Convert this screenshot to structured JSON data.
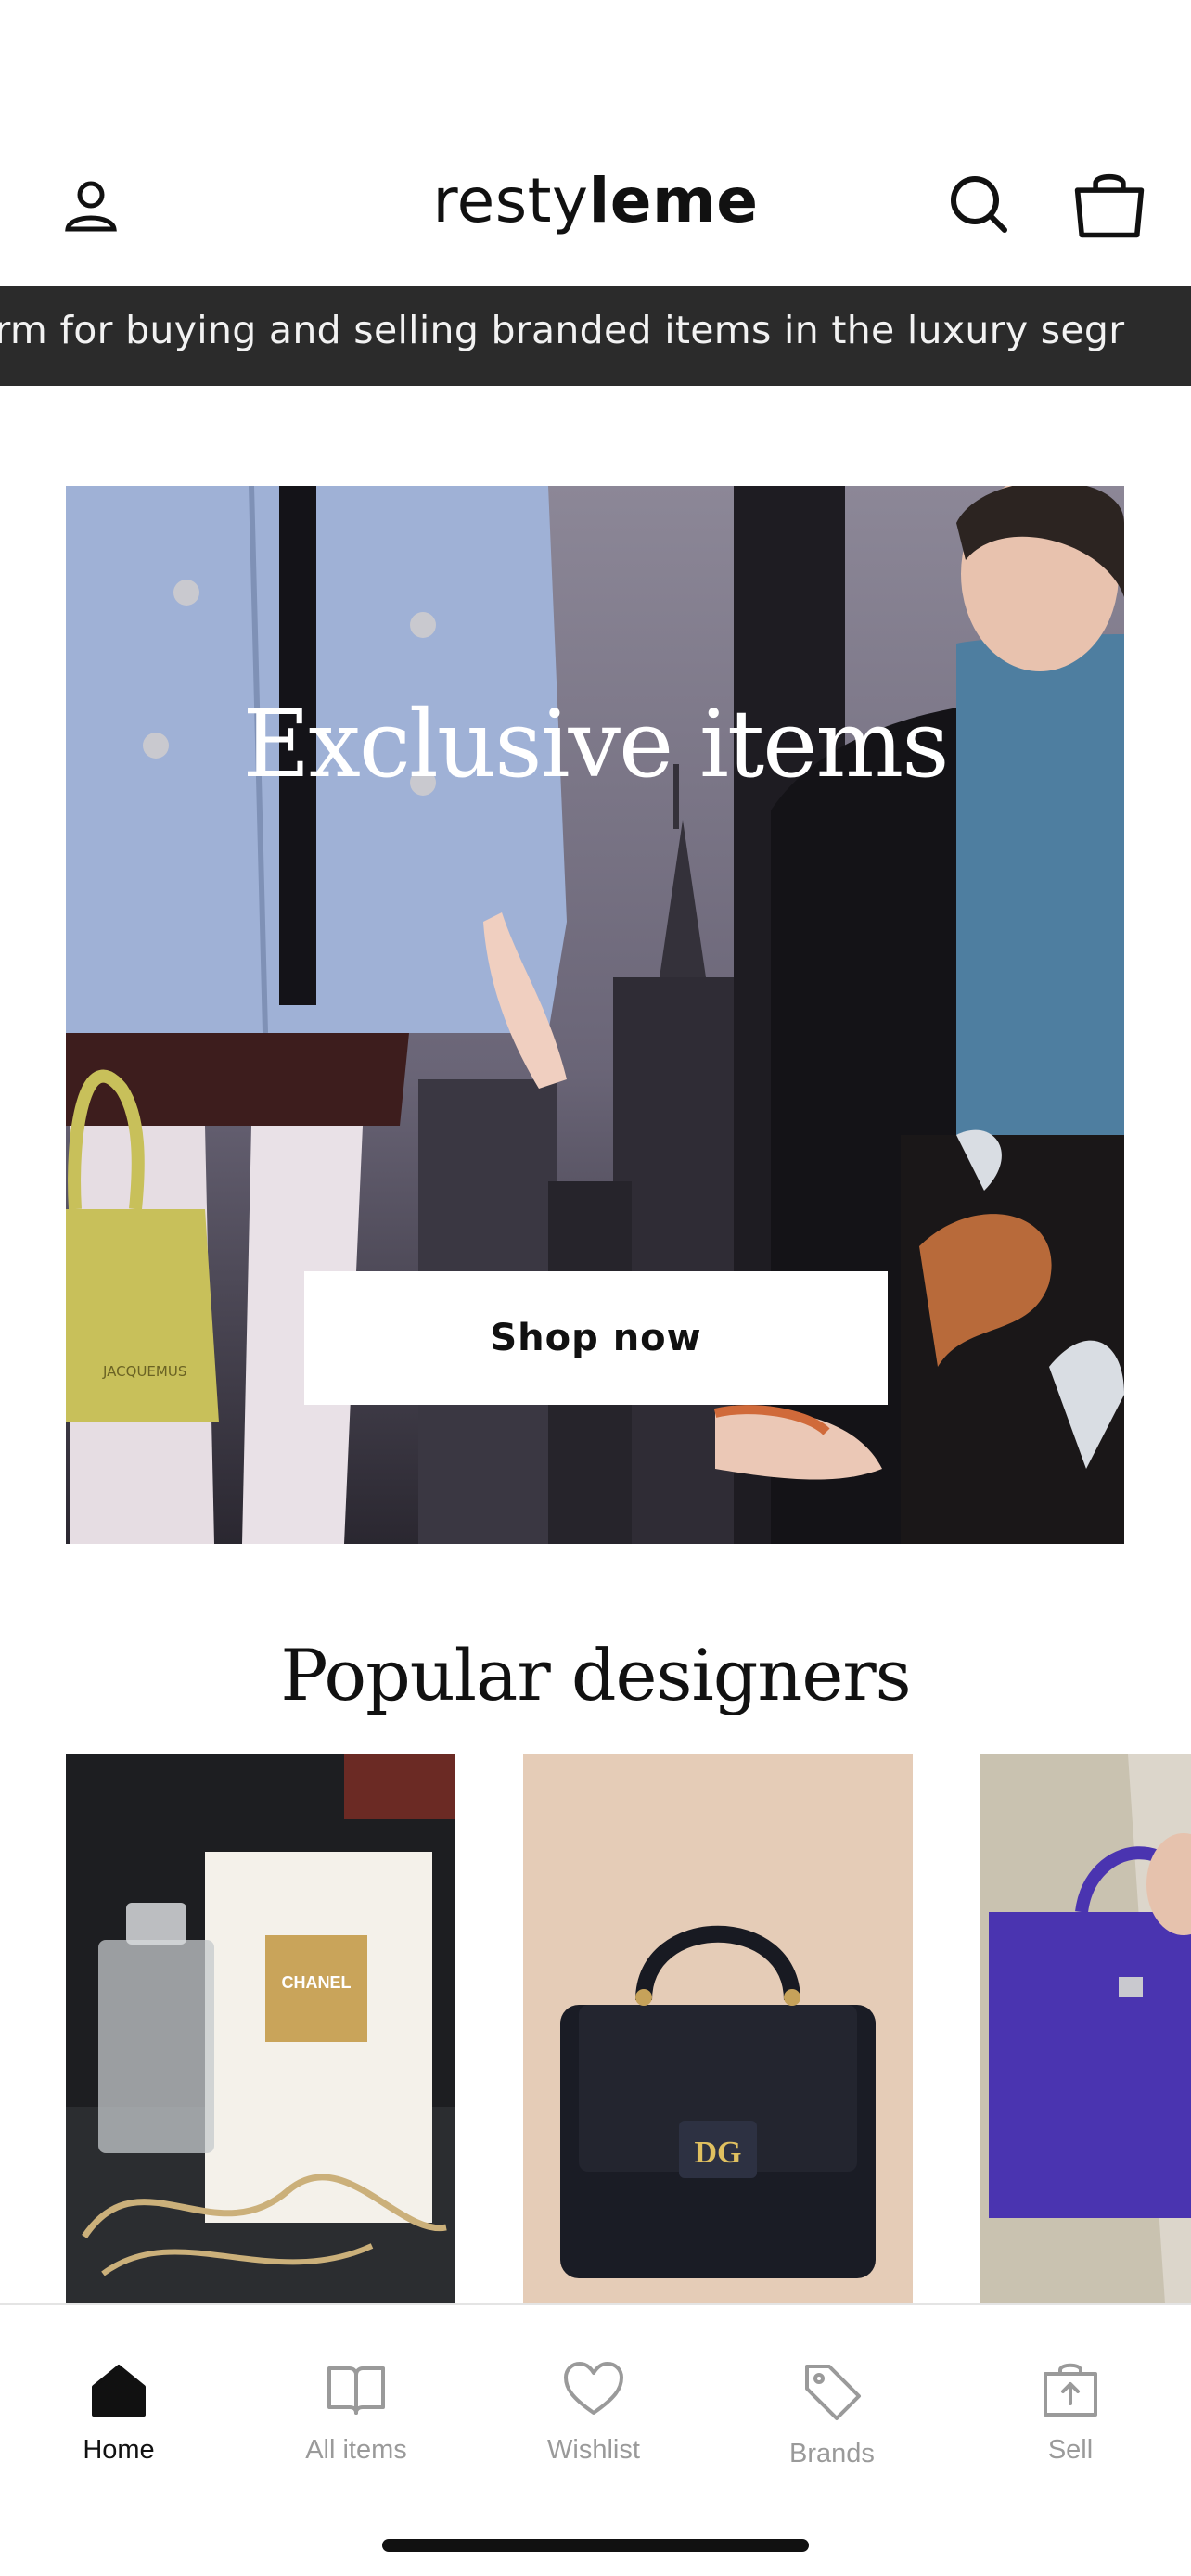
{
  "header": {
    "logo_light": "resty",
    "logo_bold": "leme",
    "icons": [
      "account-icon",
      "search-icon",
      "shopping-bag-icon"
    ]
  },
  "ticker": {
    "text": "tform for buying and selling branded items in the luxury segr"
  },
  "hero": {
    "title": "Exclusive items",
    "button_label": "Shop now",
    "bag_tag_text": "JACQUEMUS"
  },
  "popular": {
    "title": "Popular designers",
    "cards": [
      {
        "name": "chanel-card",
        "label_text": "CHANEL"
      },
      {
        "name": "dolce-gabbana-card",
        "label_text": "DG"
      },
      {
        "name": "purple-bag-card"
      }
    ]
  },
  "tabbar": {
    "items": [
      {
        "label": "Home",
        "icon": "home-icon",
        "active": true
      },
      {
        "label": "All items",
        "icon": "book-icon",
        "active": false
      },
      {
        "label": "Wishlist",
        "icon": "heart-icon",
        "active": false
      },
      {
        "label": "Brands",
        "icon": "tag-icon",
        "active": false
      },
      {
        "label": "Sell",
        "icon": "sell-bag-icon",
        "active": false
      }
    ]
  },
  "colors": {
    "ticker_bg": "#2b2b2b",
    "active_tab": "#111111",
    "inactive_tab": "#9a9a9a"
  }
}
